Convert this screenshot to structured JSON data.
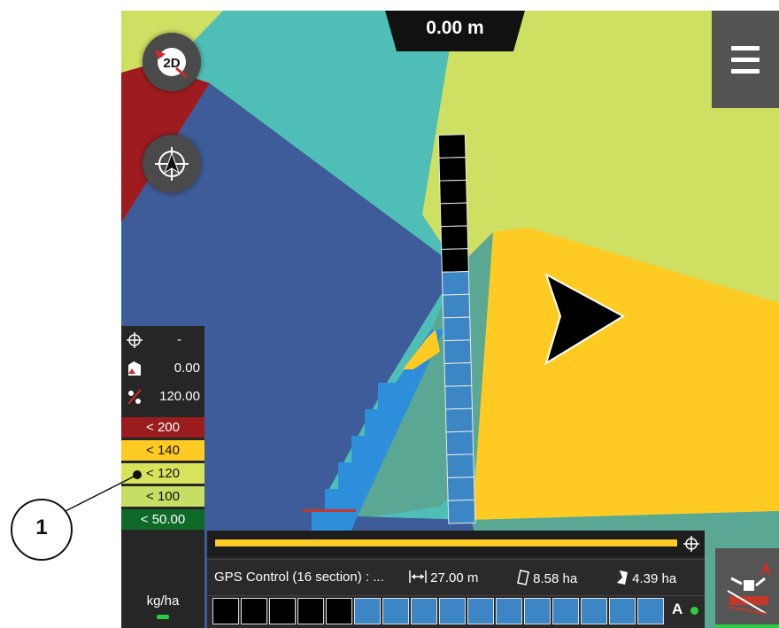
{
  "header": {
    "distance_readout": "0.00 m"
  },
  "controls": {
    "gnss_mode_label": "2D",
    "gnss_icon": "satellite-2d-icon",
    "compass_icon": "compass-icon",
    "menu_icon": "hamburger-menu-icon"
  },
  "legend": {
    "rows": [
      {
        "icon": "crosshair-icon",
        "value": "-"
      },
      {
        "icon": "area-tractor-icon",
        "value": "0.00"
      },
      {
        "icon": "percent-icon",
        "value": "120.00"
      }
    ],
    "bands": [
      {
        "label": "< 200",
        "color": "#9b1c1c",
        "text_color": "#ffffff"
      },
      {
        "label": "< 140",
        "color": "#ffcb23",
        "text_color": "#111111"
      },
      {
        "label": "< 120",
        "color": "#d7e35a",
        "text_color": "#111111"
      },
      {
        "label": "< 100",
        "color": "#c5de63",
        "text_color": "#111111"
      },
      {
        "label": "< 50.00",
        "color": "#0f6a2a",
        "text_color": "#ffffff"
      }
    ],
    "unit": "kg/ha"
  },
  "bottom_panel": {
    "progress_fraction": 1.0,
    "control_name": "GPS Control (16 section) : ...",
    "working_width": "27.00 m",
    "area_total": "8.58 ha",
    "area_partial": "4.39 ha",
    "mode_label": "A",
    "sections_total": 16,
    "sections_off": 5,
    "colors": {
      "off": "#000000",
      "on": "#3d86c6"
    }
  },
  "boom_sections": {
    "off": 6,
    "on": 11
  },
  "callout": {
    "number": "1"
  },
  "colors": {
    "map_teal": "#4fbeb6",
    "map_lime": "#cfdf62",
    "map_blue": "#3e5c99",
    "map_yellow": "#ffcb23",
    "map_red": "#9e1c1f",
    "map_green_teal": "#5aa894",
    "accent_green": "#2ecc40"
  }
}
